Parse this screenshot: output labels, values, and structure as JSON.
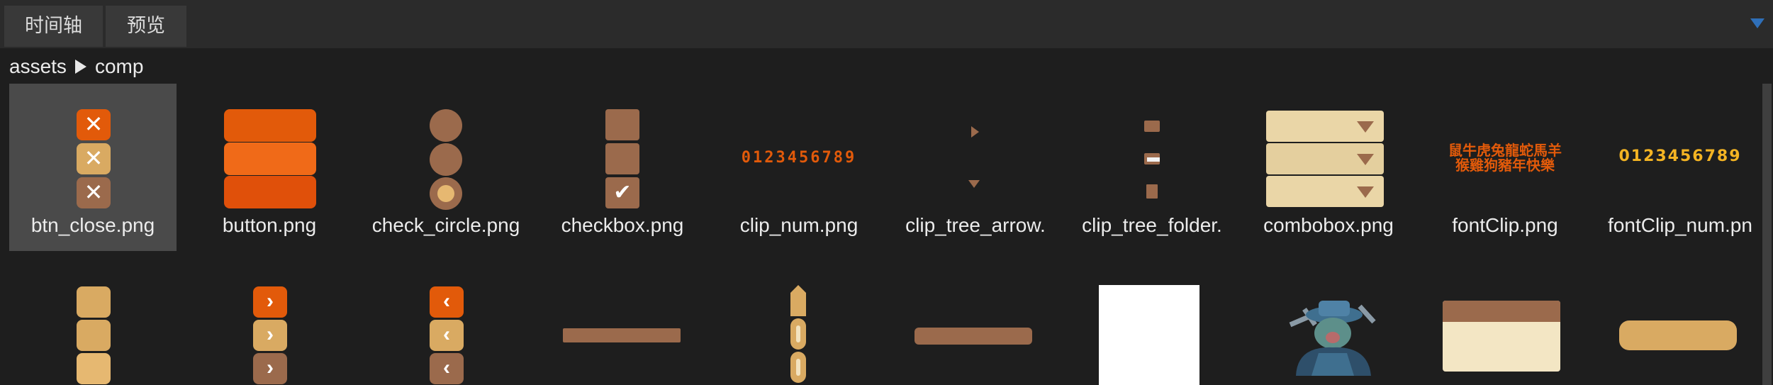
{
  "tabs": [
    {
      "label": "时间轴"
    },
    {
      "label": "预览"
    }
  ],
  "breadcrumb": {
    "root": "assets",
    "current": "comp"
  },
  "assets_row1": [
    {
      "name": "btn_close.png",
      "selected": true
    },
    {
      "name": "button.png"
    },
    {
      "name": "check_circle.png"
    },
    {
      "name": "checkbox.png"
    },
    {
      "name": "clip_num.png"
    },
    {
      "name": "clip_tree_arrow."
    },
    {
      "name": "clip_tree_folder."
    },
    {
      "name": "combobox.png"
    },
    {
      "name": "fontClip.png"
    },
    {
      "name": "fontClip_num.pn"
    }
  ],
  "clip_num_text": "0123456789",
  "fontclip_num_text": "0123456789",
  "fontclip_chars_row1": "鼠牛虎兔龍蛇馬羊",
  "fontclip_chars_row2": "猴雞狗豬年快樂",
  "colors": {
    "accent": "#2f6fb8",
    "orange": "#e25a0a",
    "tan": "#d9aa62",
    "brown": "#9b6a4c",
    "cream": "#ead6a7"
  }
}
